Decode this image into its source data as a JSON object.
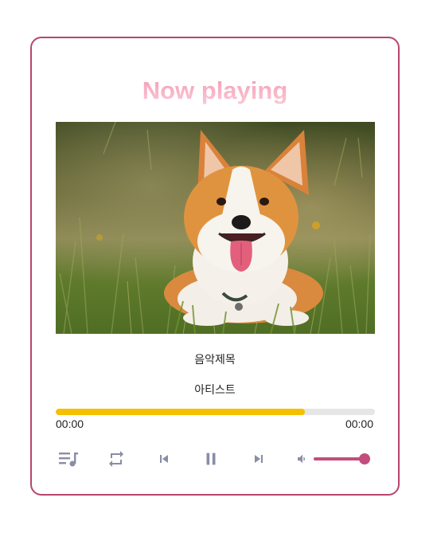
{
  "player": {
    "title": "Now playing",
    "song_title": "음악제목",
    "artist": "아티스트",
    "progress": 0.78,
    "current_time": "00:00",
    "duration": "00:00",
    "volume": 0.95,
    "album_art": "corgi-photo",
    "controls": {
      "playlist": "playlist-icon",
      "repeat": "repeat-icon",
      "previous": "skip-previous-icon",
      "play_pause": "pause-icon",
      "next": "skip-next-icon",
      "volume": "volume-icon"
    },
    "colors": {
      "border": "#b8456e",
      "title": "#f7b3c6",
      "progress_fill": "#f5c000",
      "volume_accent": "#c24d7c",
      "icon": "#8a8da6"
    }
  }
}
